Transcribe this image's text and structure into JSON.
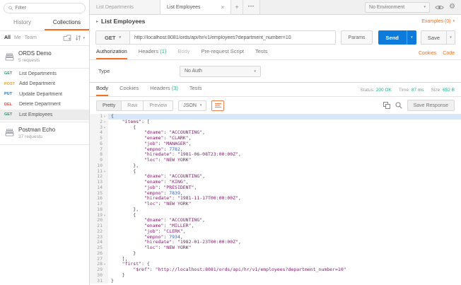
{
  "sidebar": {
    "filter_placeholder": "Filter",
    "tabs": {
      "history": "History",
      "collections": "Collections"
    },
    "scope": {
      "all": "All",
      "me": "Me",
      "team": "Team"
    },
    "collection": {
      "name": "ORDS Demo",
      "meta": "5 requests"
    },
    "requests": [
      {
        "method": "GET",
        "name": "List Departments"
      },
      {
        "method": "POST",
        "name": "Add Department"
      },
      {
        "method": "PUT",
        "name": "Update Department"
      },
      {
        "method": "DEL",
        "name": "Delete Department"
      },
      {
        "method": "GET",
        "name": "List Employees"
      }
    ],
    "echo": {
      "name": "Postman Echo",
      "meta": "37 requests"
    }
  },
  "tabbar": {
    "tab_inactive": "List Departments",
    "tab_active": "List Employees",
    "close": "×",
    "new_tab": "+",
    "more": "•••",
    "environment": "No Environment"
  },
  "request": {
    "title": "List Employees",
    "examples": "Examples (0)",
    "method": "GET",
    "url": "http://localhost:8081/ords/api/hr/v1/employees?department_number=10",
    "params": "Params",
    "send": "Send",
    "save": "Save",
    "cookies_link": "Cookies",
    "code_link": "Code",
    "tabs": {
      "authorization": "Authorization",
      "headers": "Headers",
      "headers_count": "(1)",
      "body": "Body",
      "prerequest": "Pre-request Script",
      "tests": "Tests"
    },
    "auth": {
      "type_label": "Type",
      "type_value": "No Auth"
    }
  },
  "response": {
    "tabs": {
      "body": "Body",
      "cookies": "Cookies",
      "headers": "Headers",
      "headers_count": "(3)",
      "tests": "Tests"
    },
    "status_label": "Status:",
    "status_value": "200 OK",
    "time_label": "Time:",
    "time_value": "87 ms",
    "size_label": "Size:",
    "size_value": "652 B",
    "views": {
      "pretty": "Pretty",
      "raw": "Raw",
      "preview": "Preview"
    },
    "language": "JSON",
    "save_response": "Save Response",
    "code_lines": [
      {
        "n": 1,
        "fold": true,
        "hl": true,
        "text": "{"
      },
      {
        "n": 2,
        "fold": true,
        "text": "    \"items\": ["
      },
      {
        "n": 3,
        "fold": true,
        "text": "        {"
      },
      {
        "n": 4,
        "text": "            \"dname\": \"ACCOUNTING\","
      },
      {
        "n": 5,
        "text": "            \"ename\": \"CLARK\","
      },
      {
        "n": 6,
        "text": "            \"job\": \"MANAGER\","
      },
      {
        "n": 7,
        "text": "            \"empno\": 7782,"
      },
      {
        "n": 8,
        "text": "            \"hiredate\": \"1981-06-08T23:00:00Z\","
      },
      {
        "n": 9,
        "text": "            \"loc\": \"NEW YORK\""
      },
      {
        "n": 10,
        "text": "        },"
      },
      {
        "n": 11,
        "fold": true,
        "text": "        {"
      },
      {
        "n": 12,
        "text": "            \"dname\": \"ACCOUNTING\","
      },
      {
        "n": 13,
        "text": "            \"ename\": \"KING\","
      },
      {
        "n": 14,
        "text": "            \"job\": \"PRESIDENT\","
      },
      {
        "n": 15,
        "text": "            \"empno\": 7839,"
      },
      {
        "n": 16,
        "text": "            \"hiredate\": \"1981-11-17T00:00:00Z\","
      },
      {
        "n": 17,
        "text": "            \"loc\": \"NEW YORK\""
      },
      {
        "n": 18,
        "text": "        },"
      },
      {
        "n": 19,
        "fold": true,
        "text": "        {"
      },
      {
        "n": 20,
        "text": "            \"dname\": \"ACCOUNTING\","
      },
      {
        "n": 21,
        "text": "            \"ename\": \"MILLER\","
      },
      {
        "n": 22,
        "text": "            \"job\": \"CLERK\","
      },
      {
        "n": 23,
        "text": "            \"empno\": 7934,"
      },
      {
        "n": 24,
        "text": "            \"hiredate\": \"1982-01-23T00:00:00Z\","
      },
      {
        "n": 25,
        "text": "            \"loc\": \"NEW YORK\""
      },
      {
        "n": 26,
        "text": "        }"
      },
      {
        "n": 27,
        "text": "    ],"
      },
      {
        "n": 28,
        "fold": true,
        "text": "    \"first\": {"
      },
      {
        "n": 29,
        "text": "        \"$ref\": \"http://localhost:8081/ords/api/hr/v1/employees?department_number=10\""
      },
      {
        "n": 30,
        "text": "    }"
      },
      {
        "n": 31,
        "text": "}"
      }
    ]
  },
  "colors": {
    "accent_orange": "#f47023",
    "send_blue": "#0c7bdc",
    "status_green": "#26b47f",
    "method_get": "#21a06b",
    "method_post": "#e6a23c",
    "method_put": "#2f6fb7",
    "method_del": "#d9534f"
  }
}
